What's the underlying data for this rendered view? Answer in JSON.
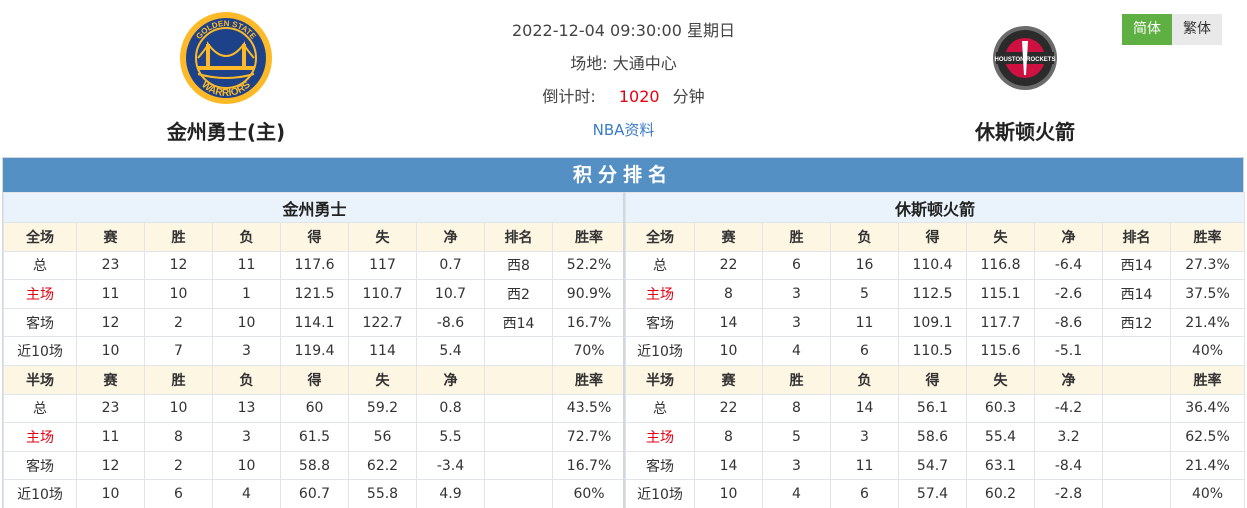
{
  "header": {
    "home_team": "金州勇士(主)",
    "away_team": "休斯顿火箭",
    "datetime": "2022-12-04 09:30:00 星期日",
    "venue_label": "场地:",
    "venue": "大通中心",
    "countdown_label": "倒计时:",
    "countdown_value": "1020",
    "countdown_unit": "分钟",
    "nba_link": "NBA资料",
    "lang_simplified": "简体",
    "lang_traditional": "繁体"
  },
  "logos": {
    "home_top": "GOLDEN STATE",
    "home_bottom": "WARRIORS",
    "away_text": "HOUSTON ROCKETS"
  },
  "standings": {
    "title": "积分排名",
    "home": {
      "team": "金州勇士",
      "full_header": [
        "全场",
        "赛",
        "胜",
        "负",
        "得",
        "失",
        "净",
        "排名",
        "胜率"
      ],
      "full_rows": [
        [
          "总",
          "23",
          "12",
          "11",
          "117.6",
          "117",
          "0.7",
          "西8",
          "52.2%"
        ],
        [
          "主场",
          "11",
          "10",
          "1",
          "121.5",
          "110.7",
          "10.7",
          "西2",
          "90.9%"
        ],
        [
          "客场",
          "12",
          "2",
          "10",
          "114.1",
          "122.7",
          "-8.6",
          "西14",
          "16.7%"
        ],
        [
          "近10场",
          "10",
          "7",
          "3",
          "119.4",
          "114",
          "5.4",
          "",
          "70%"
        ]
      ],
      "half_header": [
        "半场",
        "赛",
        "胜",
        "负",
        "得",
        "失",
        "净",
        "",
        "胜率"
      ],
      "half_rows": [
        [
          "总",
          "23",
          "10",
          "13",
          "60",
          "59.2",
          "0.8",
          "",
          "43.5%"
        ],
        [
          "主场",
          "11",
          "8",
          "3",
          "61.5",
          "56",
          "5.5",
          "",
          "72.7%"
        ],
        [
          "客场",
          "12",
          "2",
          "10",
          "58.8",
          "62.2",
          "-3.4",
          "",
          "16.7%"
        ],
        [
          "近10场",
          "10",
          "6",
          "4",
          "60.7",
          "55.8",
          "4.9",
          "",
          "60%"
        ]
      ]
    },
    "away": {
      "team": "休斯顿火箭",
      "full_header": [
        "全场",
        "赛",
        "胜",
        "负",
        "得",
        "失",
        "净",
        "排名",
        "胜率"
      ],
      "full_rows": [
        [
          "总",
          "22",
          "6",
          "16",
          "110.4",
          "116.8",
          "-6.4",
          "西14",
          "27.3%"
        ],
        [
          "主场",
          "8",
          "3",
          "5",
          "112.5",
          "115.1",
          "-2.6",
          "西14",
          "37.5%"
        ],
        [
          "客场",
          "14",
          "3",
          "11",
          "109.1",
          "117.7",
          "-8.6",
          "西12",
          "21.4%"
        ],
        [
          "近10场",
          "10",
          "4",
          "6",
          "110.5",
          "115.6",
          "-5.1",
          "",
          "40%"
        ]
      ],
      "half_header": [
        "半场",
        "赛",
        "胜",
        "负",
        "得",
        "失",
        "净",
        "",
        "胜率"
      ],
      "half_rows": [
        [
          "总",
          "22",
          "8",
          "14",
          "56.1",
          "60.3",
          "-4.2",
          "",
          "36.4%"
        ],
        [
          "主场",
          "8",
          "5",
          "3",
          "58.6",
          "55.4",
          "3.2",
          "",
          "62.5%"
        ],
        [
          "客场",
          "14",
          "3",
          "11",
          "54.7",
          "63.1",
          "-8.4",
          "",
          "21.4%"
        ],
        [
          "近10场",
          "10",
          "4",
          "6",
          "57.4",
          "60.2",
          "-2.8",
          "",
          "40%"
        ]
      ]
    }
  },
  "colors": {
    "title_bar": "#5590c4",
    "team_row": "#eaf3fb",
    "head_row": "#fdf6e3",
    "home_highlight": "#e60012",
    "lang_active": "#5fb043"
  }
}
